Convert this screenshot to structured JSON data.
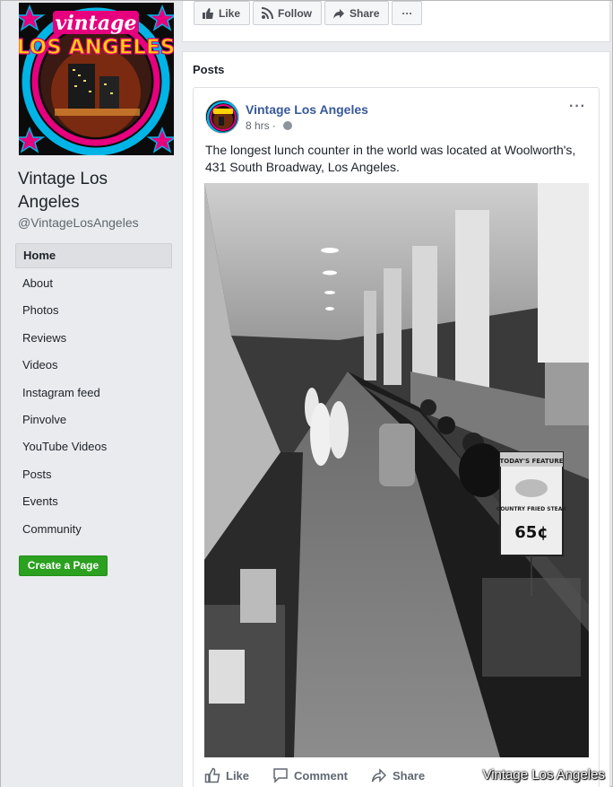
{
  "page": {
    "name": "Vintage Los Angeles",
    "handle": "@VintageLosAngeles",
    "logo_text_top": "vintage",
    "logo_text_main": "LOS ANGELES"
  },
  "sidebar": {
    "items": [
      {
        "label": "Home",
        "active": true
      },
      {
        "label": "About"
      },
      {
        "label": "Photos"
      },
      {
        "label": "Reviews"
      },
      {
        "label": "Videos"
      },
      {
        "label": "Instagram feed"
      },
      {
        "label": "Pinvolve"
      },
      {
        "label": "YouTube Videos"
      },
      {
        "label": "Posts"
      },
      {
        "label": "Events"
      },
      {
        "label": "Community"
      }
    ],
    "create_page_label": "Create a Page"
  },
  "topbar": {
    "like_label": "Like",
    "follow_label": "Follow",
    "share_label": "Share",
    "more_label": "···"
  },
  "posts": {
    "section_title": "Posts",
    "post": {
      "author": "Vintage Los Angeles",
      "time": "8 hrs",
      "more_label": "···",
      "text": "The longest lunch counter in the world was located at Woolworth's, 431 South Broadway, Los Angeles.",
      "photo_sign_title": "TODAY'S FEATURE",
      "photo_sign_dish": "COUNTRY FRIED STEAK",
      "photo_sign_price": "65¢",
      "actions": {
        "like_label": "Like",
        "comment_label": "Comment",
        "share_label": "Share"
      }
    }
  },
  "watermark": "Vintage Los Angeles",
  "colors": {
    "link": "#385898",
    "create_button": "#2ba11f",
    "background": "#e9ebee",
    "logo_pink": "#e6007e",
    "logo_cyan": "#00b4e6",
    "logo_yellow": "#ffd200"
  }
}
